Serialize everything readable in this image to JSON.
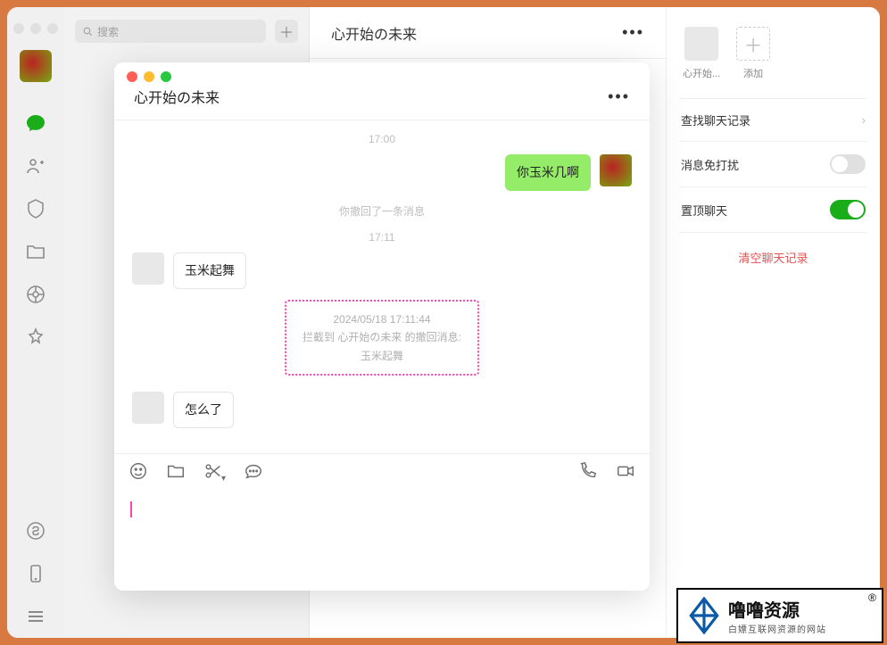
{
  "search": {
    "placeholder": "搜索"
  },
  "main_header": {
    "title": "心开始の未来"
  },
  "info_panel": {
    "member_label": "心开始...",
    "add_label": "添加",
    "search_history": "查找聊天记录",
    "mute": "消息免打扰",
    "pin": "置顶聊天",
    "clear": "清空聊天记录"
  },
  "popup": {
    "title": "心开始の未来",
    "time_top": "17:00",
    "msg_out": "你玉米几啊",
    "recall_notice": "你撤回了一条消息",
    "time_mid": "17:11",
    "msg_in1": "玉米起舞",
    "intercept_time": "2024/05/18 17:11:44",
    "intercept_line": "拦截到 心开始の未来 的撤回消息:",
    "intercept_content": "玉米起舞",
    "msg_in2": "怎么了"
  },
  "watermark": {
    "main": "噜噜资源",
    "sub": "白嫖互联网资源的网站",
    "reg": "®"
  }
}
